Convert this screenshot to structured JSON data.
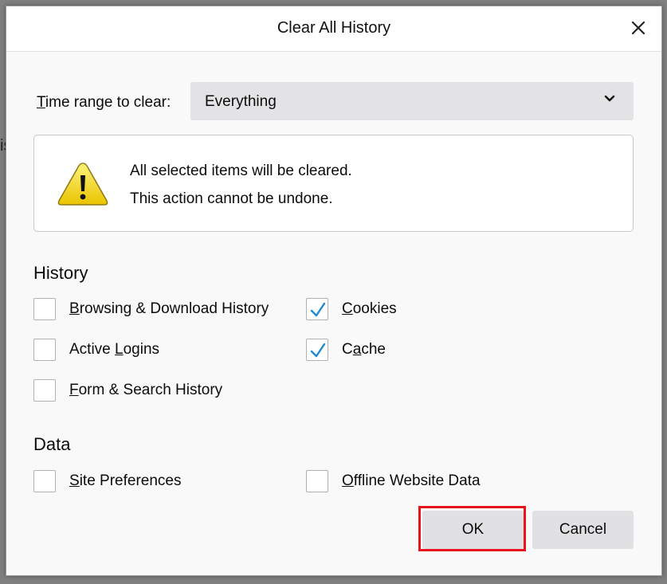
{
  "backdrop": {
    "partial_text": "is"
  },
  "dialog": {
    "title": "Clear All History",
    "close_icon": "close-icon"
  },
  "time_range": {
    "label_first": "T",
    "label_rest": "ime range to clear:",
    "selected": "Everything"
  },
  "warning": {
    "icon": "warning-icon",
    "line1": "All selected items will be cleared.",
    "line2": "This action cannot be undone."
  },
  "history": {
    "heading": "History",
    "items": [
      {
        "pre": "",
        "key": "B",
        "post": "rowsing & Download History",
        "checked": false
      },
      {
        "pre": "Active ",
        "key": "L",
        "post": "ogins",
        "checked": false
      },
      {
        "pre": "",
        "key": "F",
        "post": "orm & Search History",
        "checked": false
      },
      {
        "pre": "",
        "key": "C",
        "post": "ookies",
        "checked": true
      },
      {
        "pre": "C",
        "key": "a",
        "post": "che",
        "checked": true
      }
    ]
  },
  "data": {
    "heading": "Data",
    "items": [
      {
        "pre": "",
        "key": "S",
        "post": "ite Preferences",
        "checked": false
      },
      {
        "pre": "",
        "key": "O",
        "post": "ffline Website Data",
        "checked": false
      }
    ]
  },
  "buttons": {
    "ok": "OK",
    "cancel": "Cancel"
  },
  "colors": {
    "checkmark": "#1f8ad1",
    "highlight": "#e8161c",
    "dialog_bg": "#f9f9fa"
  }
}
